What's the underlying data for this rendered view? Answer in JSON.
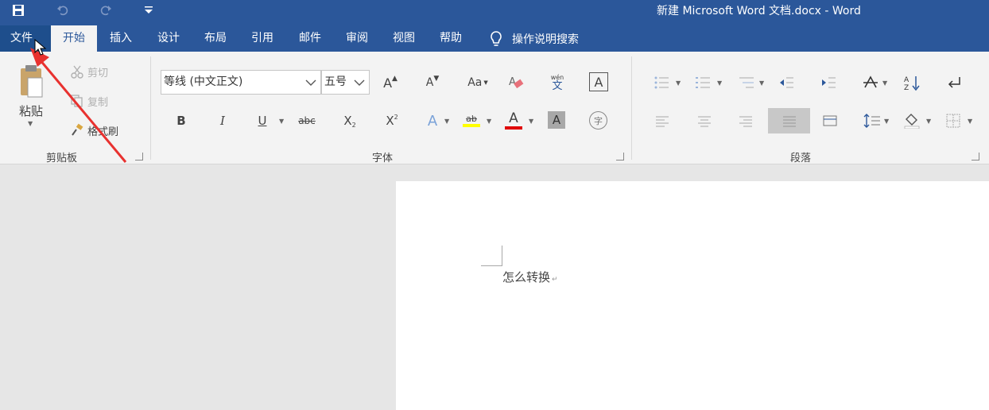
{
  "titlebar": {
    "title": "新建 Microsoft Word 文档.docx  -  Word",
    "save_icon": "save-icon",
    "undo_icon": "undo-icon",
    "redo_icon": "redo-icon"
  },
  "tabs": {
    "file": "文件",
    "home": "开始",
    "insert": "插入",
    "design": "设计",
    "layout": "布局",
    "references": "引用",
    "mailings": "邮件",
    "review": "审阅",
    "view": "视图",
    "help": "帮助",
    "tell_me": "操作说明搜索"
  },
  "clipboard": {
    "paste": "粘贴",
    "cut": "剪切",
    "copy": "复制",
    "format_painter": "格式刷",
    "group_label": "剪贴板"
  },
  "font": {
    "font_name": "等线 (中文正文)",
    "font_size": "五号",
    "grow_font": "A",
    "shrink_font": "A",
    "change_case": "Aa",
    "phonetic_guide_top": "wén",
    "phonetic_guide_bottom": "文",
    "char_border": "A",
    "bold": "B",
    "italic": "I",
    "underline": "U",
    "strikethrough": "abc",
    "subscript": "X",
    "superscript": "X",
    "subscript_mark": "2",
    "superscript_mark": "2",
    "text_effects": "A",
    "highlight": "ab",
    "font_color": "A",
    "char_shading": "A",
    "enclose_char": "字",
    "group_label": "字体"
  },
  "paragraph": {
    "group_label": "段落"
  },
  "document": {
    "text": "怎么转换"
  },
  "colors": {
    "brand": "#2b579a",
    "highlight_yellow": "#ffff00",
    "font_red": "#e00000",
    "arrow_red": "#e8312f"
  }
}
